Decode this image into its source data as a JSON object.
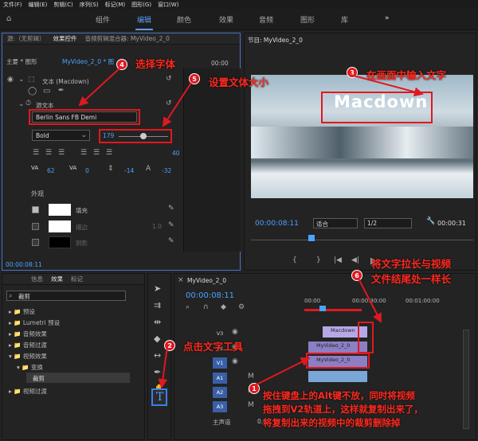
{
  "menu": [
    "文件(F)",
    "编辑(E)",
    "剪辑(C)",
    "序列(S)",
    "标记(M)",
    "图形(G)",
    "窗口(W)"
  ],
  "workspaces": [
    "组件",
    "编辑",
    "颜色",
    "效果",
    "音频",
    "图形",
    "库"
  ],
  "workspace_more": "»",
  "effect_panel": {
    "tabs": [
      "源:（无剪辑）",
      "效果控件",
      "音频剪辑混合器: MyVideo_2_0"
    ],
    "crumb_main": "主要 * 图形",
    "crumb_seq": "MyVideo_2_0 * 图",
    "time": "00:00",
    "text_layer": "文本 (Macdown)",
    "source_text": "源文本",
    "font": "Berlin Sans FB Demi",
    "style": "Bold",
    "size_value": "179",
    "tracking": "62",
    "kerning": "0",
    "leading": "-14",
    "baseline": "-32",
    "small_val": "40",
    "appearance": "外观",
    "fill_label": "填充",
    "stroke_label": "描边",
    "stroke_val": "1.0",
    "shadow_label": "阴影",
    "footer_time": "00:00:08:11"
  },
  "program": {
    "title": "节目: MyVideo_2_0",
    "overlay_text": "Macdown",
    "timecode": "00:00:08:11",
    "fit": "适合",
    "ratio": "1/2",
    "end_time": "00:00:31"
  },
  "project_panel": {
    "tabs": [
      "信息",
      "效果",
      "标记"
    ],
    "search": "裁剪",
    "items": [
      "预设",
      "Lumetri 预设",
      "音频效果",
      "音频过渡",
      "视频效果",
      "变换",
      "裁剪",
      "视频过渡"
    ]
  },
  "timeline": {
    "title": "MyVideo_2_0",
    "timecode": "00:00:08:11",
    "ruler": [
      "00:00",
      "00:00:30:00",
      "00:01:00:00"
    ],
    "tracks_v": [
      "V3",
      "V2",
      "V1"
    ],
    "tracks_a": [
      "A1",
      "A2",
      "A3"
    ],
    "master": "主声道",
    "master_val": "0.0",
    "clip_text": "Macdown",
    "clip_v2": "MyVideo_2_0",
    "clip_v1": "MyVideo_2_0"
  },
  "annotations": {
    "n1": "1",
    "n2": "2",
    "n3": "3",
    "n4": "4",
    "n5": "5",
    "n6": "6",
    "a1": "按住键盘上的Alt键不放，同时将视频\n拖拽到V2轨道上，这样就复制出来了，\n将复制出来的视频中的裁剪删除掉",
    "a2": "点击文字工具",
    "a3": "在画面中输入文字",
    "a4": "选择字体",
    "a5": "设置文体大小",
    "a6": "将文字拉长与视频\n文件结尾处一样长"
  },
  "colors": {
    "accent": "#4aa3ff",
    "annotation": "#e0181f",
    "clip_purple": "#8c7fc4",
    "clip_blue": "#7aa6d8"
  }
}
